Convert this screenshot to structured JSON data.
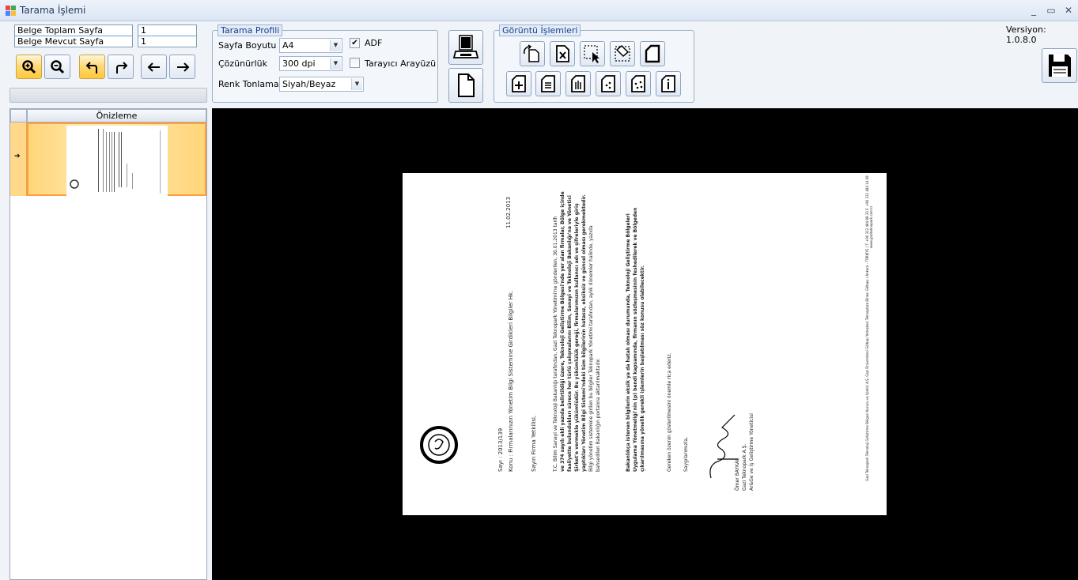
{
  "window": {
    "title": "Tarama İşlemi",
    "minimize": "_",
    "maximize": "▭",
    "close": "✕"
  },
  "info": {
    "total_label": "Belge Toplam Sayfa",
    "total_value": "1",
    "current_label": "Belge Mevcut Sayfa",
    "current_value": "1"
  },
  "toolbar": {
    "zoom_in_icon": "zoom-in-icon",
    "zoom_out_icon": "zoom-out-icon",
    "rotate_left_icon": "rotate-left-icon",
    "rotate_right_icon": "rotate-right-icon",
    "prev_icon": "arrow-left-icon",
    "next_icon": "arrow-right-icon"
  },
  "preview": {
    "header": "Önizleme",
    "row_marker": "➔"
  },
  "profile": {
    "legend": "Tarama Profili",
    "page_size_label": "Sayfa Boyutu",
    "page_size_value": "A4",
    "resolution_label": "Çözünürlük",
    "resolution_value": "300 dpi",
    "color_label": "Renk Tonlama",
    "color_value": "Siyah/Beyaz",
    "adf_label": "ADF",
    "adf_checked": true,
    "scanner_ui_label": "Tarayıcı Arayüzü",
    "scanner_ui_checked": false
  },
  "image_ops": {
    "legend": "Görüntü İşlemleri"
  },
  "version": "Versiyon: 1.0.8.0",
  "colors": {
    "accent": "#ffc83a",
    "viewer_bg": "#000000",
    "selection_border": "#ff9c3b"
  },
  "document": {
    "date": "11.02.2013",
    "number": "Sayı   : 2013/139",
    "subject": "Konu  : Firmalarınızın Yönetim Bilgi Sistemine Girdikleri Bilgiler Hk.",
    "greeting": "Sayın Firma Yetkilisi,",
    "para1_l1": "T.C. Bilim Sanayi ve Teknoloji Bakanlığı tarafından, Gazi Teknopark Yönetimi'ne gönderilen, 30.01.2013 tarih",
    "para1_l2": "ve 374 sayılı ekli yazıda belirtildiği üzere, Teknoloji Geliştirme Bölgesi'nde yer alan firmalar, Bölge içinde",
    "para1_l3": "faaliyette bulundukları sürece her türlü çalışmalarını Bilim, Sanayi ve Teknoloji Bakanlığı'na ve Yönetici",
    "para1_l4": "Şirket'e vermekle yükümlüdür. Bu yükümlülük gereği, firmalarımızın kullanıcı adı ve şifreleriyle giriş",
    "para1_l5": "yaptıkları Yönetim Bilgi Sistemi'ndeki tüm bilgilerinin hatasız, eksiksiz ve güncel olması gerekmektedir.",
    "para1_l6": "Bilgi yönetim sistemine girilen bu bilgiler Teknopark Yönetimi tarafından, aylık dönemler halinde, yazıda",
    "para1_l7": "bahsedilen Bakanlığın portalına aktarılmaktadır.",
    "para2_l1": "Bakanlıkça istenen bilgilerin eksik ya da hatalı olması durumunda, Teknoloji Geliştirme Bölgeleri",
    "para2_l2": "Uygulama Yönetmeliği'nin (p) bendi kapsamında, firmanın sözleşmesinin feshedilerek ve Bölgeden",
    "para2_l3": "çıkarılmasına yönelik gerekli işlemlerin başlatılması söz konusu olabilecektir.",
    "closing1": "Gereken özenin gösterilmesini önemle rica ederiz.",
    "closing2": "Saygılarımızla,",
    "sign_name": "Ömer BAYKAL",
    "sign_company": "Gazi Teknopark A.Ş.",
    "sign_title": "Ar&Ge ve İş Geliştirme Yöneticisi",
    "footer": "Gazi Teknopark Teknoloji Geliştirme Bölgesi Kurucu ve İşletici A.Ş. Gazi Üniversitesi Gölbaşı Yerleşkesi Teknoplaza Binası Gölbaşı / Ankara - TÜRKİYE | T: +90 312 484 88 33 F: +90 312 484 14 09",
    "footer_url": "www.gaziteknopark.com.tr"
  }
}
